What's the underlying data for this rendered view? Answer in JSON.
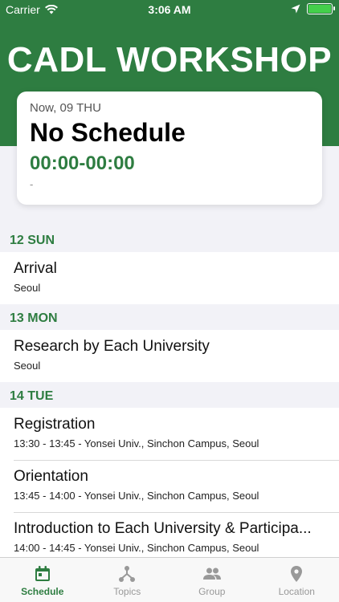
{
  "status_bar": {
    "carrier": "Carrier",
    "time": "3:06 AM"
  },
  "header": {
    "title": "CADL WORKSHOP"
  },
  "now_card": {
    "label": "Now, 09 THU",
    "title": "No Schedule",
    "time": "00:00-00:00",
    "place": "-"
  },
  "sections": [
    {
      "header": "12 SUN",
      "items": [
        {
          "title": "Arrival",
          "subtitle": "Seoul"
        }
      ]
    },
    {
      "header": "13 MON",
      "items": [
        {
          "title": "Research by Each University",
          "subtitle": "Seoul"
        }
      ]
    },
    {
      "header": "14 TUE",
      "items": [
        {
          "title": "Registration",
          "subtitle": "13:30 - 13:45 - Yonsei Univ., Sinchon Campus, Seoul"
        },
        {
          "title": "Orientation",
          "subtitle": "13:45 - 14:00 - Yonsei Univ., Sinchon Campus, Seoul"
        },
        {
          "title": "Introduction to Each University & Participa...",
          "subtitle": "14:00 - 14:45 - Yonsei Univ., Sinchon Campus, Seoul"
        }
      ]
    }
  ],
  "tabs": [
    {
      "label": "Schedule",
      "icon": "calendar-icon"
    },
    {
      "label": "Topics",
      "icon": "topics-icon"
    },
    {
      "label": "Group",
      "icon": "group-icon"
    },
    {
      "label": "Location",
      "icon": "location-pin-icon"
    }
  ],
  "colors": {
    "brand": "#2e7d41",
    "background": "#f2f2f7",
    "inactive_tab": "#999999"
  }
}
